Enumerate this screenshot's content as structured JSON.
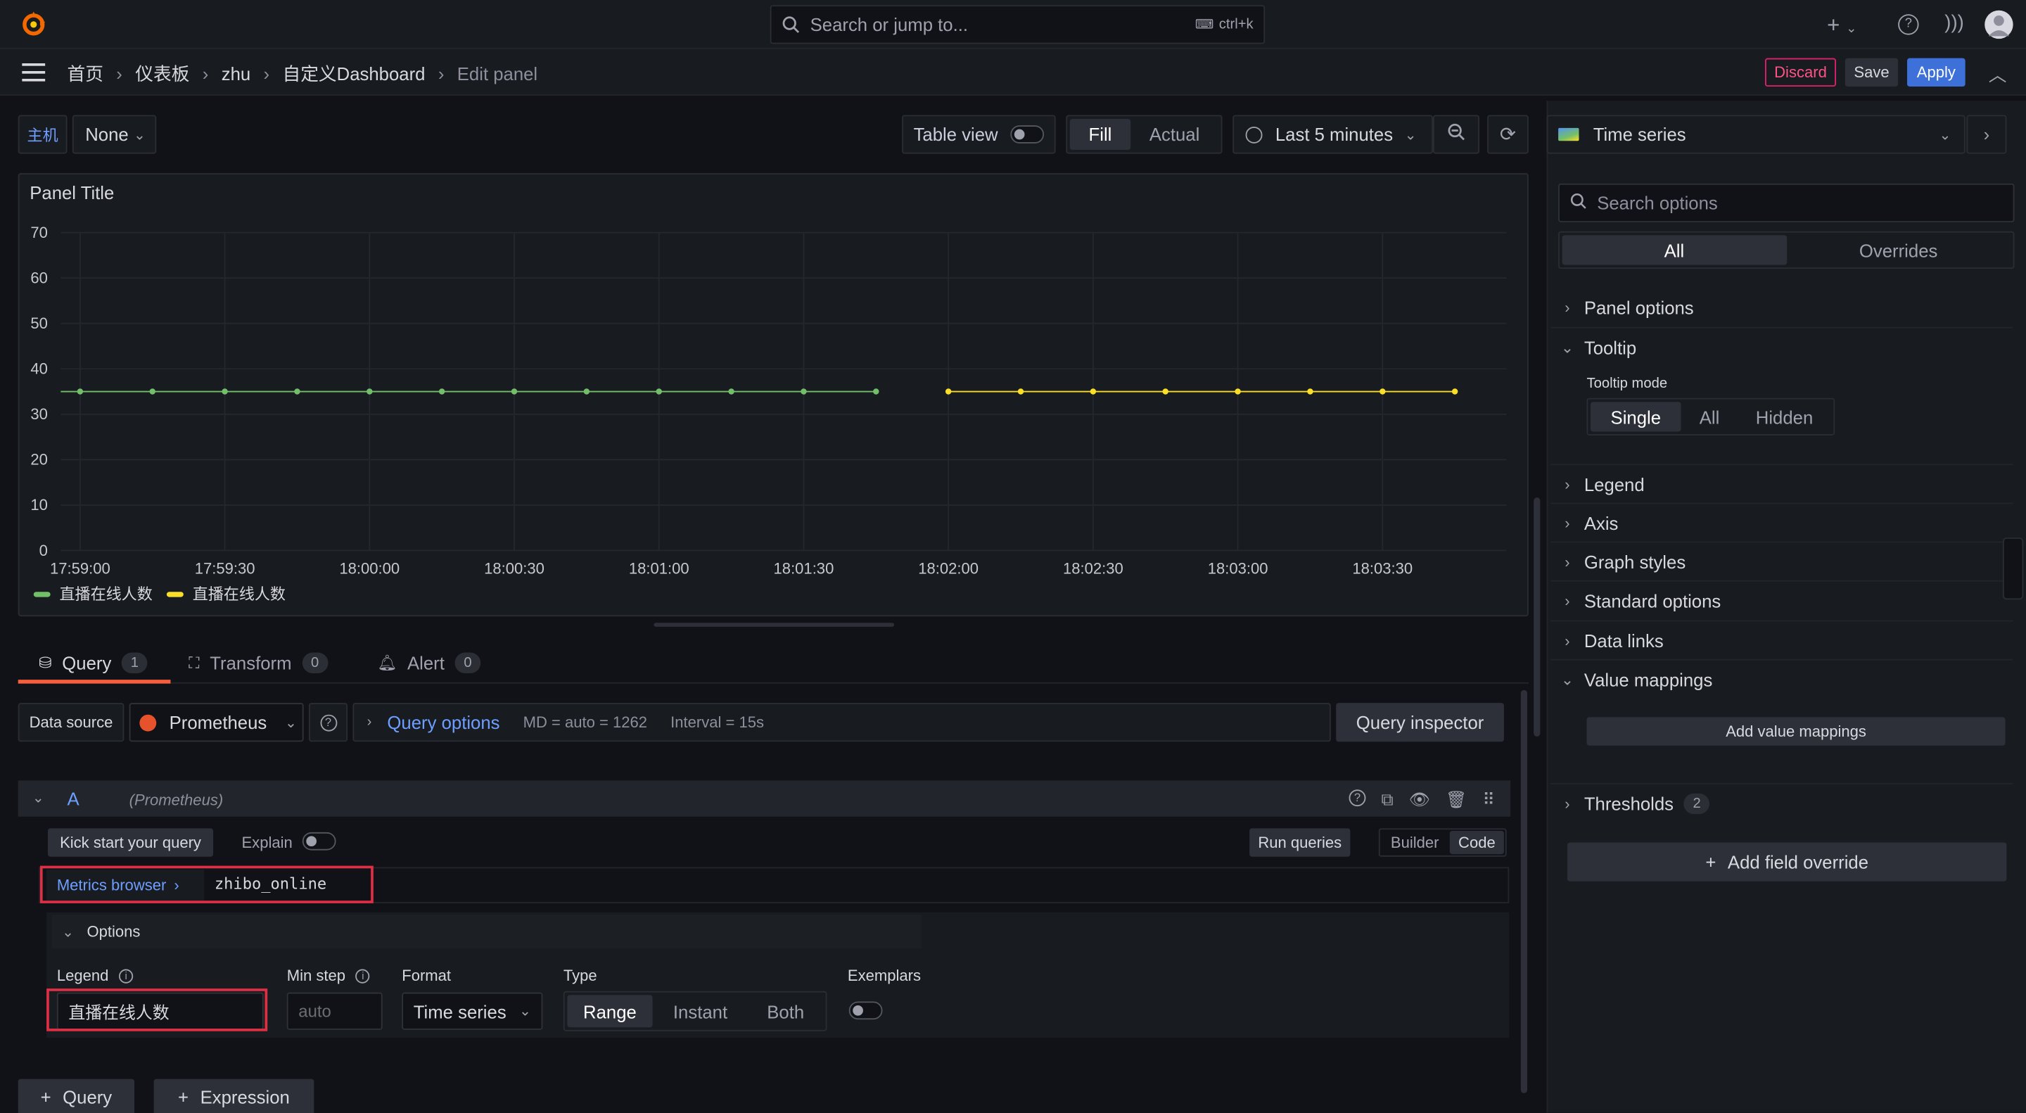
{
  "topbar": {
    "search_placeholder": "Search or jump to...",
    "shortcut": "ctrl+k",
    "breadcrumb": [
      "首页",
      "仪表板",
      "zhu",
      "自定义Dashboard",
      "Edit panel"
    ],
    "discard": "Discard",
    "save": "Save",
    "apply": "Apply"
  },
  "toolbar": {
    "variable_label": "主机",
    "variable_value": "None",
    "table_view": "Table view",
    "fill": "Fill",
    "actual": "Actual",
    "time_range": "Last 5 minutes"
  },
  "panel": {
    "title": "Panel Title",
    "legend": [
      "直播在线人数",
      "直播在线人数"
    ]
  },
  "chart_data": {
    "type": "line",
    "title": "Panel Title",
    "ylim": [
      0,
      70
    ],
    "y_ticks": [
      "70",
      "60",
      "50",
      "40",
      "30",
      "20",
      "10",
      "0"
    ],
    "x_ticks": [
      "17:59:00",
      "17:59:30",
      "18:00:00",
      "18:00:30",
      "18:01:00",
      "18:01:30",
      "18:02:00",
      "18:02:30",
      "18:03:00",
      "18:03:30"
    ],
    "grid": true,
    "legend_placement": "bottom-left",
    "series": [
      {
        "name": "直播在线人数",
        "color": "#73bf69",
        "x": [
          "17:59:00",
          "17:59:15",
          "17:59:30",
          "17:59:45",
          "18:00:00",
          "18:00:15",
          "18:00:30",
          "18:00:45",
          "18:01:00",
          "18:01:15",
          "18:01:30",
          "18:01:45"
        ],
        "values": [
          35,
          35,
          35,
          35,
          35,
          35,
          35,
          35,
          35,
          35,
          35,
          35
        ]
      },
      {
        "name": "直播在线人数",
        "color": "#fade2a",
        "x": [
          "18:02:00",
          "18:02:15",
          "18:02:30",
          "18:02:45",
          "18:03:00",
          "18:03:15",
          "18:03:30",
          "18:03:45"
        ],
        "values": [
          35,
          35,
          35,
          35,
          35,
          35,
          35,
          35
        ]
      }
    ]
  },
  "tabs": [
    {
      "label": "Query",
      "count": "1"
    },
    {
      "label": "Transform",
      "count": "0"
    },
    {
      "label": "Alert",
      "count": "0"
    }
  ],
  "query": {
    "datasource_label": "Data source",
    "datasource": "Prometheus",
    "query_options": "Query options",
    "md": "MD = auto = 1262",
    "interval": "Interval = 15s",
    "inspector": "Query inspector",
    "ref_id": "A",
    "ds_hint": "(Prometheus)",
    "kick_start": "Kick start your query",
    "explain": "Explain",
    "run_queries": "Run queries",
    "builder": "Builder",
    "code": "Code",
    "metrics_browser": "Metrics browser",
    "expr": "zhibo_online",
    "options_label": "Options",
    "legend_label": "Legend",
    "legend_value": "直播在线人数",
    "min_step_label": "Min step",
    "min_step_placeholder": "auto",
    "format_label": "Format",
    "format_value": "Time series",
    "type_label": "Type",
    "type_options": [
      "Range",
      "Instant",
      "Both"
    ],
    "exemplars_label": "Exemplars",
    "add_query": "Query",
    "add_expression": "Expression"
  },
  "options_pane": {
    "viz": "Time series",
    "search_placeholder": "Search options",
    "tab_all": "All",
    "tab_overrides": "Overrides",
    "sections": [
      "Panel options",
      "Tooltip",
      "Legend",
      "Axis",
      "Graph styles",
      "Standard options",
      "Data links",
      "Value mappings",
      "Thresholds"
    ],
    "tooltip_mode_label": "Tooltip mode",
    "tooltip_modes": [
      "Single",
      "All",
      "Hidden"
    ],
    "add_value_mappings": "Add value mappings",
    "thresholds_count": "2",
    "add_field_override": "Add field override"
  },
  "colors": {
    "accent": "#3d71d9",
    "discard": "#e0226e",
    "tab_underline": "#f55f3e",
    "highlight_box": "#e02f44"
  }
}
